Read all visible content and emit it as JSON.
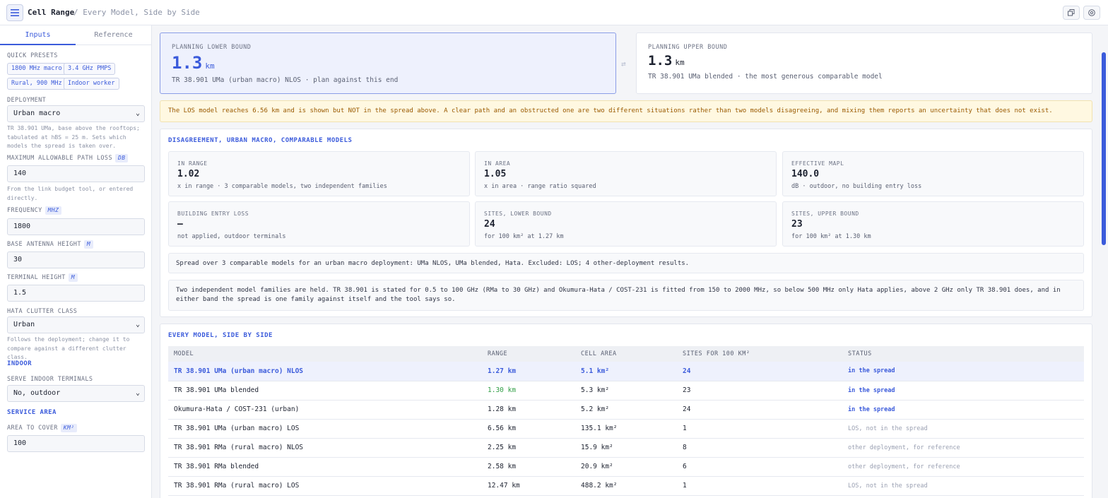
{
  "header": {
    "app_title": "Cell Range",
    "breadcrumb": "/ Every Model, Side by Side"
  },
  "icons": {
    "menu": "hamburger-menu-icon",
    "copy": "copy-icon",
    "help": "help-circle-icon",
    "swap": "swap-arrows-icon"
  },
  "sidebar": {
    "tabs": [
      "Inputs",
      "Reference"
    ],
    "quick_presets_label": "QUICK PRESETS",
    "presets": [
      "1800 MHz macro",
      "3.4 GHz PMPS",
      "Rural, 900 MHz",
      "Indoor worker"
    ],
    "deployment": {
      "label": "DEPLOYMENT",
      "value": "Urban macro",
      "help": "TR 38.901 UMa, base above the rooftops; tabulated at hBS = 25 m. Sets which models the spread is taken over."
    },
    "mapl": {
      "label": "MAXIMUM ALLOWABLE PATH LOSS",
      "unit": "DB",
      "value": "140",
      "help": "From the link budget tool, or entered directly."
    },
    "frequency": {
      "label": "FREQUENCY",
      "unit": "MHZ",
      "value": "1800"
    },
    "base_height": {
      "label": "BASE ANTENNA HEIGHT",
      "unit": "M",
      "value": "30"
    },
    "terminal_height": {
      "label": "TERMINAL HEIGHT",
      "unit": "M",
      "value": "1.5"
    },
    "clutter": {
      "label": "HATA CLUTTER CLASS",
      "value": "Urban",
      "help": "Follows the deployment; change it to compare against a different clutter class."
    },
    "indoor_heading": "INDOOR",
    "serve_indoor": {
      "label": "SERVE INDOOR TERMINALS",
      "value": "No, outdoor"
    },
    "service_area_heading": "SERVICE AREA",
    "area": {
      "label": "AREA TO COVER",
      "unit": "KM²",
      "value": "100"
    }
  },
  "bounds": {
    "lower": {
      "label": "PLANNING LOWER BOUND",
      "value": "1.3",
      "unit": "km",
      "desc": "TR 38.901 UMa (urban macro) NLOS · plan against this end"
    },
    "upper": {
      "label": "PLANNING UPPER BOUND",
      "value": "1.3",
      "unit": "km",
      "desc": "TR 38.901 UMa blended · the most generous comparable model"
    }
  },
  "warning": "The LOS model reaches 6.56 km and is shown but NOT in the spread above. A clear path and an obstructed one are two different situations rather than two models disagreeing, and mixing them reports an uncertainty that does not exist.",
  "disagreement": {
    "title": "DISAGREEMENT, URBAN MACRO, COMPARABLE MODELS",
    "stats": [
      {
        "label": "IN RANGE",
        "value": "1.02",
        "sub": "x in range · 3 comparable models, two independent families"
      },
      {
        "label": "IN AREA",
        "value": "1.05",
        "sub": "x in area · range ratio squared"
      },
      {
        "label": "EFFECTIVE MAPL",
        "value": "140.0",
        "sub": "dB · outdoor, no building entry loss"
      },
      {
        "label": "BUILDING ENTRY LOSS",
        "value": "—",
        "sub": "not applied, outdoor terminals"
      },
      {
        "label": "SITES, LOWER BOUND",
        "value": "24",
        "sub": "for 100 km² at 1.27 km"
      },
      {
        "label": "SITES, UPPER BOUND",
        "value": "23",
        "sub": "for 100 km² at 1.30 km"
      }
    ],
    "note1": "Spread over 3 comparable models for an urban macro deployment: UMa NLOS, UMa blended, Hata. Excluded: LOS; 4 other-deployment results.",
    "note2": "Two independent model families are held. TR 38.901 is stated for 0.5 to 100 GHz (RMa to 30 GHz) and Okumura-Hata / COST-231 is fitted from 150 to 2000 MHz, so below 500 MHz only Hata applies, above 2 GHz only TR 38.901 does, and in either band the spread is one family against itself and the tool says so."
  },
  "models": {
    "title": "EVERY MODEL, SIDE BY SIDE",
    "columns": [
      "MODEL",
      "RANGE",
      "CELL AREA",
      "SITES FOR 100 KM²",
      "STATUS"
    ],
    "rows": [
      {
        "model": "TR 38.901 UMa (urban macro) NLOS",
        "range": "1.27 km",
        "area": "5.1 km²",
        "sites": "24",
        "status": "in the spread"
      },
      {
        "model": "TR 38.901 UMa blended",
        "range": "1.30 km",
        "area": "5.3 km²",
        "sites": "23",
        "status": "in the spread"
      },
      {
        "model": "Okumura-Hata / COST-231 (urban)",
        "range": "1.28 km",
        "area": "5.2 km²",
        "sites": "24",
        "status": "in the spread"
      },
      {
        "model": "TR 38.901 UMa (urban macro) LOS",
        "range": "6.56 km",
        "area": "135.1 km²",
        "sites": "1",
        "status": "LOS, not in the spread"
      },
      {
        "model": "TR 38.901 RMa (rural macro) NLOS",
        "range": "2.25 km",
        "area": "15.9 km²",
        "sites": "8",
        "status": "other deployment, for reference"
      },
      {
        "model": "TR 38.901 RMa blended",
        "range": "2.58 km",
        "area": "20.9 km²",
        "sites": "6",
        "status": "other deployment, for reference"
      },
      {
        "model": "TR 38.901 RMa (rural macro) LOS",
        "range": "12.47 km",
        "area": "488.2 km²",
        "sites": "1",
        "status": "LOS, not in the spread"
      }
    ]
  },
  "colors": {
    "accent": "#3b5bdb",
    "warning_bg": "#fff8e1",
    "warning_text": "#9a5a00",
    "upper_highlight": "#2f9e44"
  }
}
